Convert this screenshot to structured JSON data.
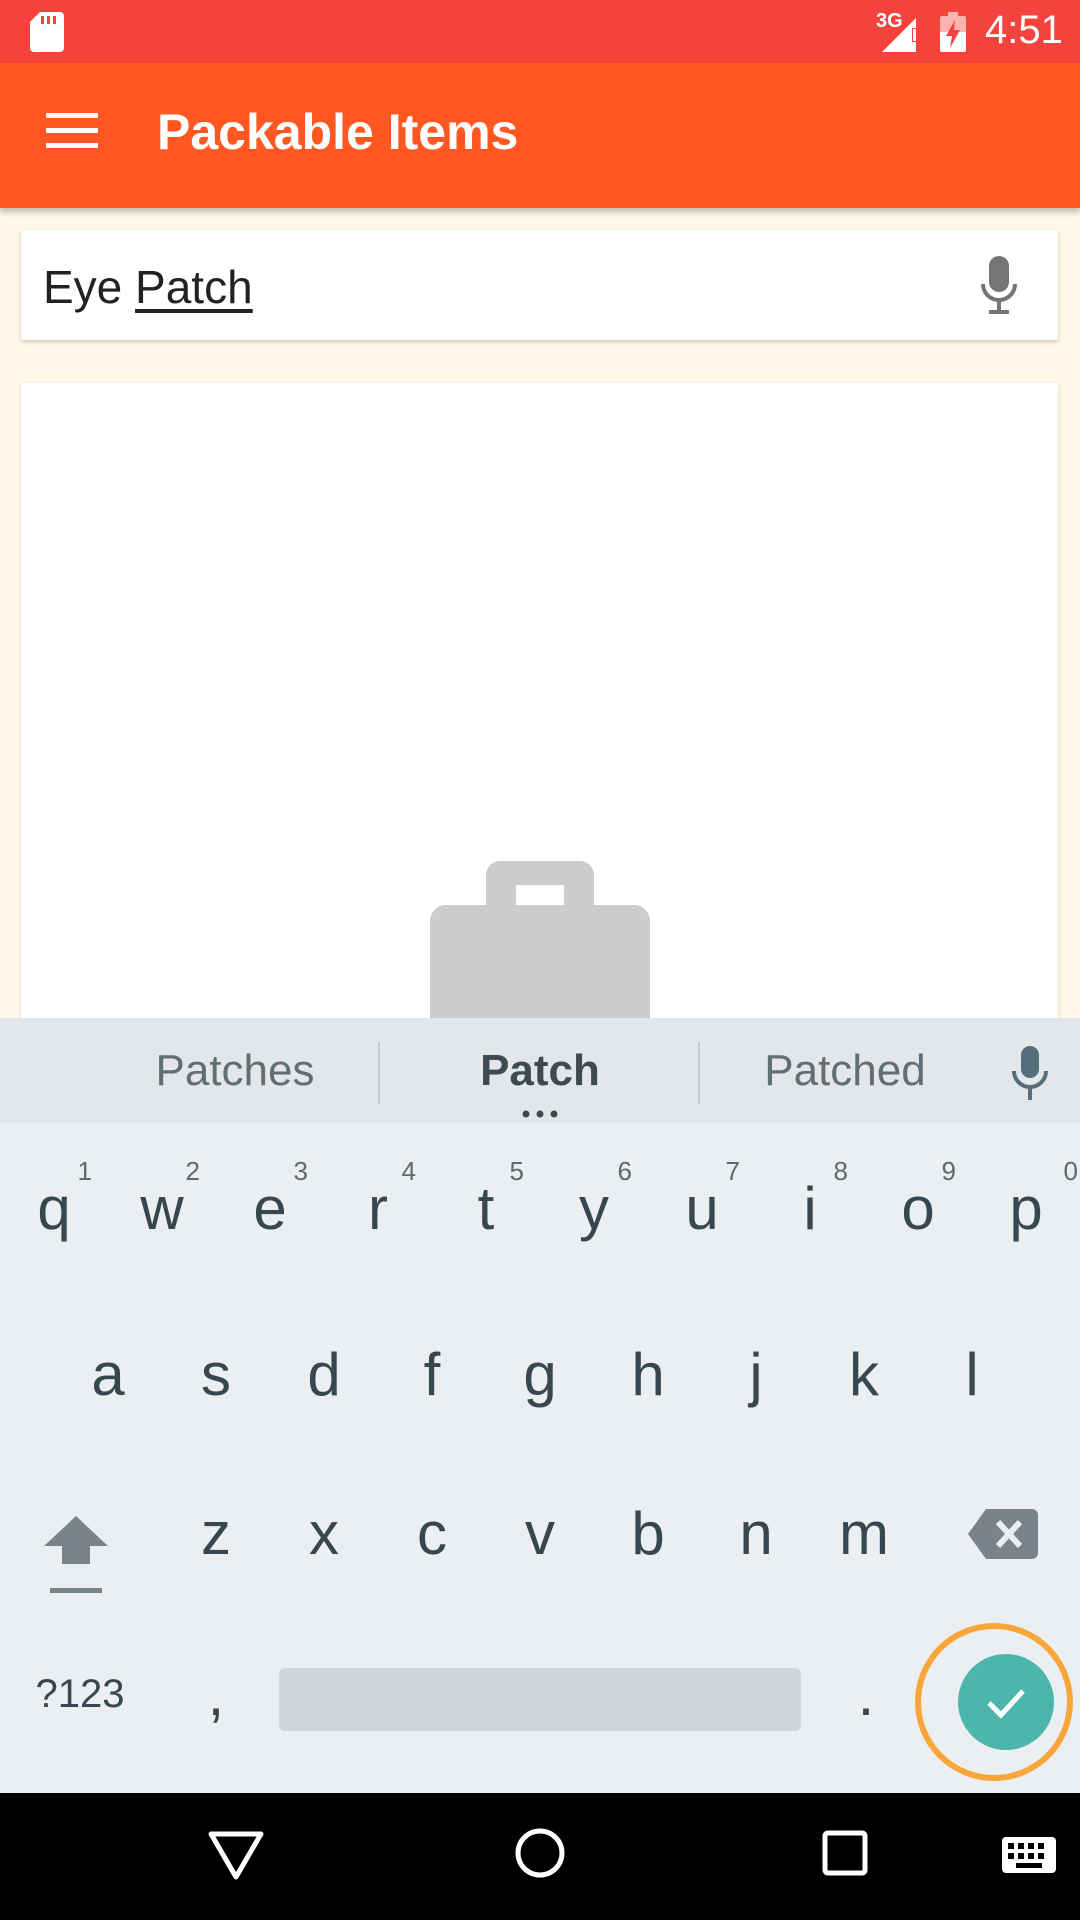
{
  "status_bar": {
    "network_label": "3G",
    "time": "4:51",
    "icons": [
      "sd-card-icon",
      "signal-icon",
      "battery-charging-icon"
    ]
  },
  "toolbar": {
    "title": "Packable Items",
    "menu_icon": "hamburger-menu-icon"
  },
  "search": {
    "committed_text": "Eye ",
    "composing_text": "Patch",
    "mic_icon": "microphone-icon"
  },
  "content": {
    "placeholder_icon": "briefcase-icon"
  },
  "keyboard": {
    "suggestions": [
      "Patches",
      "Patch",
      "Patched"
    ],
    "row1": [
      {
        "letter": "q",
        "hint": "1"
      },
      {
        "letter": "w",
        "hint": "2"
      },
      {
        "letter": "e",
        "hint": "3"
      },
      {
        "letter": "r",
        "hint": "4"
      },
      {
        "letter": "t",
        "hint": "5"
      },
      {
        "letter": "y",
        "hint": "6"
      },
      {
        "letter": "u",
        "hint": "7"
      },
      {
        "letter": "i",
        "hint": "8"
      },
      {
        "letter": "o",
        "hint": "9"
      },
      {
        "letter": "p",
        "hint": "0"
      }
    ],
    "row2": [
      "a",
      "s",
      "d",
      "f",
      "g",
      "h",
      "j",
      "k",
      "l"
    ],
    "row3": [
      "z",
      "x",
      "c",
      "v",
      "b",
      "n",
      "m"
    ],
    "symbols_label": "?123",
    "comma_label": ",",
    "period_label": ".",
    "enter_icon": "checkmark-icon"
  },
  "colors": {
    "status_bar": "#F4433C",
    "toolbar": "#FF5722",
    "enter_button": "#4DB6AC",
    "highlight_ring": "#F8A53A"
  }
}
